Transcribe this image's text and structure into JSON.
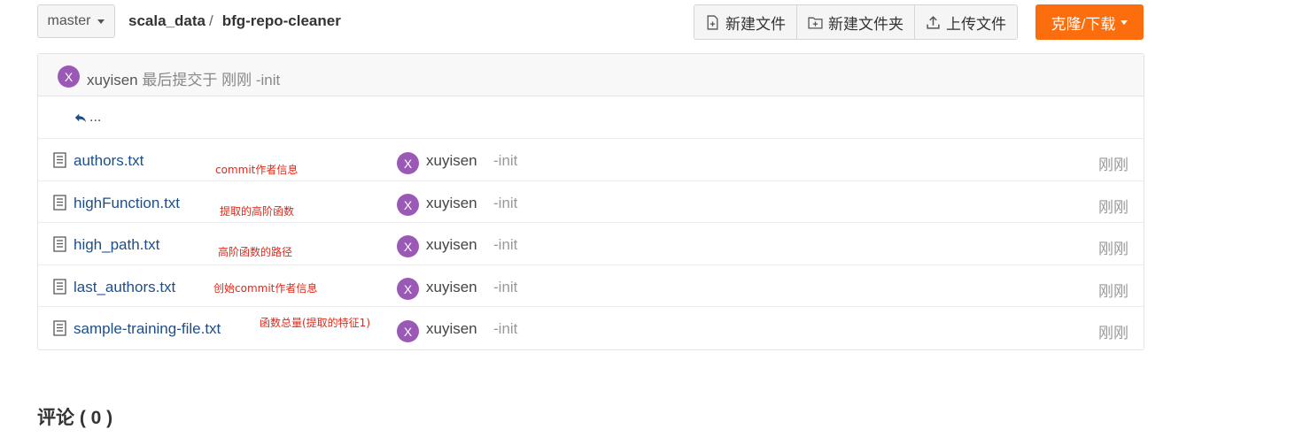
{
  "toolbar": {
    "branch": "master",
    "repo_owner": "scala_data",
    "separator": "/",
    "repo_name": "bfg-repo-cleaner",
    "new_file": "新建文件",
    "new_folder": "新建文件夹",
    "upload_file": "上传文件",
    "clone_download": "克隆/下载"
  },
  "commit": {
    "avatar_letter": "X",
    "user": "xuyisen",
    "info": "最后提交于 刚刚 -init"
  },
  "back": {
    "label": "..."
  },
  "files": [
    {
      "name": "authors.txt",
      "note": "commit作者信息",
      "avatar": "X",
      "user": "xuyisen",
      "message": "-init",
      "time": "刚刚"
    },
    {
      "name": "highFunction.txt",
      "note": "提取的高阶函数",
      "avatar": "X",
      "user": "xuyisen",
      "message": "-init",
      "time": "刚刚"
    },
    {
      "name": "high_path.txt",
      "note": "高阶函数的路径",
      "avatar": "X",
      "user": "xuyisen",
      "message": "-init",
      "time": "刚刚"
    },
    {
      "name": "last_authors.txt",
      "note": "创始commit作者信息",
      "avatar": "X",
      "user": "xuyisen",
      "message": "-init",
      "time": "刚刚"
    },
    {
      "name": "sample-training-file.txt",
      "note": "函数总量(提取的特征1)",
      "avatar": "X",
      "user": "xuyisen",
      "message": "-init",
      "time": "刚刚"
    }
  ],
  "comments": {
    "title": "评论 ( 0 )"
  },
  "colors": {
    "accent": "#fb6d0d",
    "avatar": "#9b59b6",
    "link": "#1d4e89",
    "annotation": "#e0281a"
  }
}
